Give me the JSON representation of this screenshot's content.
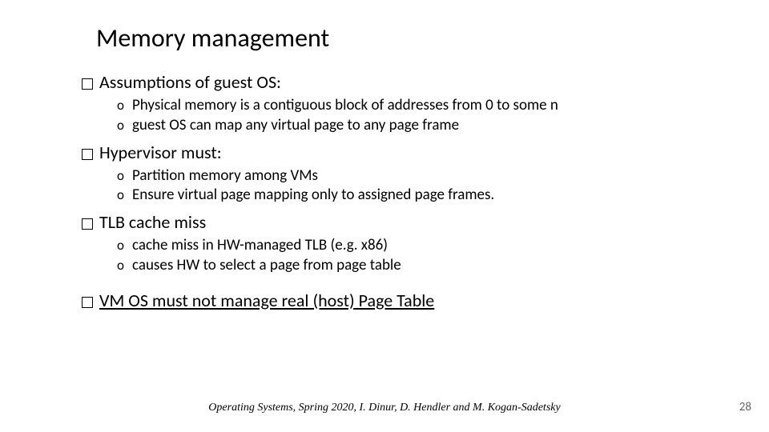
{
  "title": "Memory management",
  "sections": [
    {
      "heading": "Assumptions of guest OS:",
      "underline": false,
      "items": [
        "Physical memory is a contiguous block of addresses from 0 to some n",
        "guest OS can map any virtual page to any page frame"
      ]
    },
    {
      "heading": "Hypervisor must:",
      "underline": false,
      "items": [
        "Partition memory among VMs",
        "Ensure virtual page mapping only to assigned page frames."
      ]
    },
    {
      "heading": "TLB cache miss",
      "underline": false,
      "items": [
        "cache miss in HW-managed TLB (e.g. x86)",
        "causes HW to select a page from page table"
      ]
    },
    {
      "heading": "VM OS must not manage real (host) Page Table",
      "underline": true,
      "items": []
    }
  ],
  "footer": "Operating Systems, Spring 2020, I. Dinur,  D. Hendler and M. Kogan-Sadetsky",
  "page_number": "28"
}
